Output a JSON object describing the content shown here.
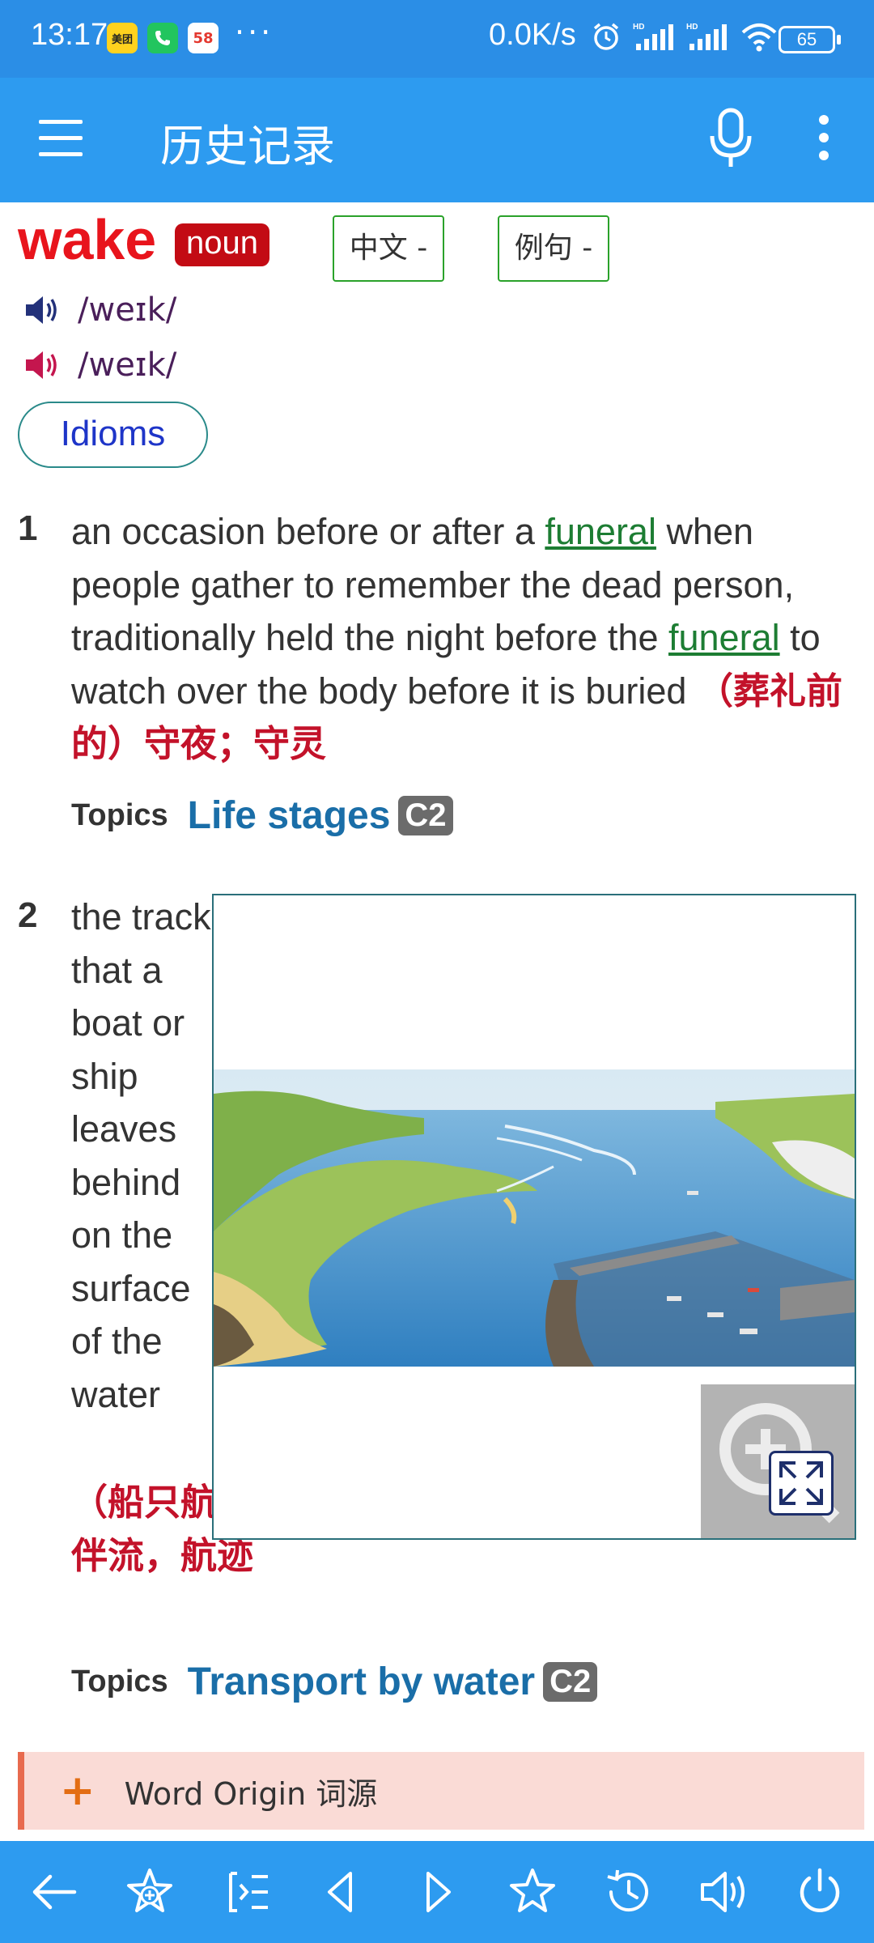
{
  "status_bar": {
    "time": "13:17",
    "apps": [
      "美团",
      "58"
    ],
    "dots": "···",
    "net_speed": "0.0K/s",
    "battery": "65"
  },
  "app_bar": {
    "title": "历史记录",
    "icons": [
      "menu-icon",
      "mic-icon",
      "more-vertical-icon"
    ]
  },
  "entry": {
    "headword": "wake",
    "pos": "noun",
    "toggle_chinese": "中文 -",
    "toggle_examples": "例句 -",
    "pron_uk": "/weɪk/",
    "pron_us": "/weɪk/",
    "idioms_label": "Idioms"
  },
  "senses": [
    {
      "num": "1",
      "def_parts": [
        "an occasion before or after a ",
        "funeral",
        " when people gather to remember the dead person, traditionally held the night before the ",
        "funeral",
        " to watch over the body before it is buried "
      ],
      "chinese": "（葬礼前的）守夜；守灵",
      "topics_label": "Topics",
      "topic": "Life stages",
      "cefr": "C2"
    },
    {
      "num": "2",
      "definition": "the track that a boat or ship leaves behind on the surface of the water",
      "chinese": "（船只航行时的）尾流，伴流，航迹",
      "topics_label": "Topics",
      "topic": "Transport by water",
      "cefr": "C2"
    }
  ],
  "word_origin": {
    "label": "Word Origin 词源"
  },
  "bottom_bar": {
    "icons": [
      "back-arrow-icon",
      "add-favorite-icon",
      "word-list-icon",
      "previous-icon",
      "next-icon",
      "favorites-icon",
      "history-icon",
      "speaker-icon",
      "power-icon"
    ]
  },
  "colors": {
    "app_bar": "#2d9bf0",
    "status_bar": "#2b8ee6",
    "headword": "#e8141c",
    "link": "#1d7d33",
    "chinese": "#c3122a",
    "topic": "#1a6ea8"
  }
}
